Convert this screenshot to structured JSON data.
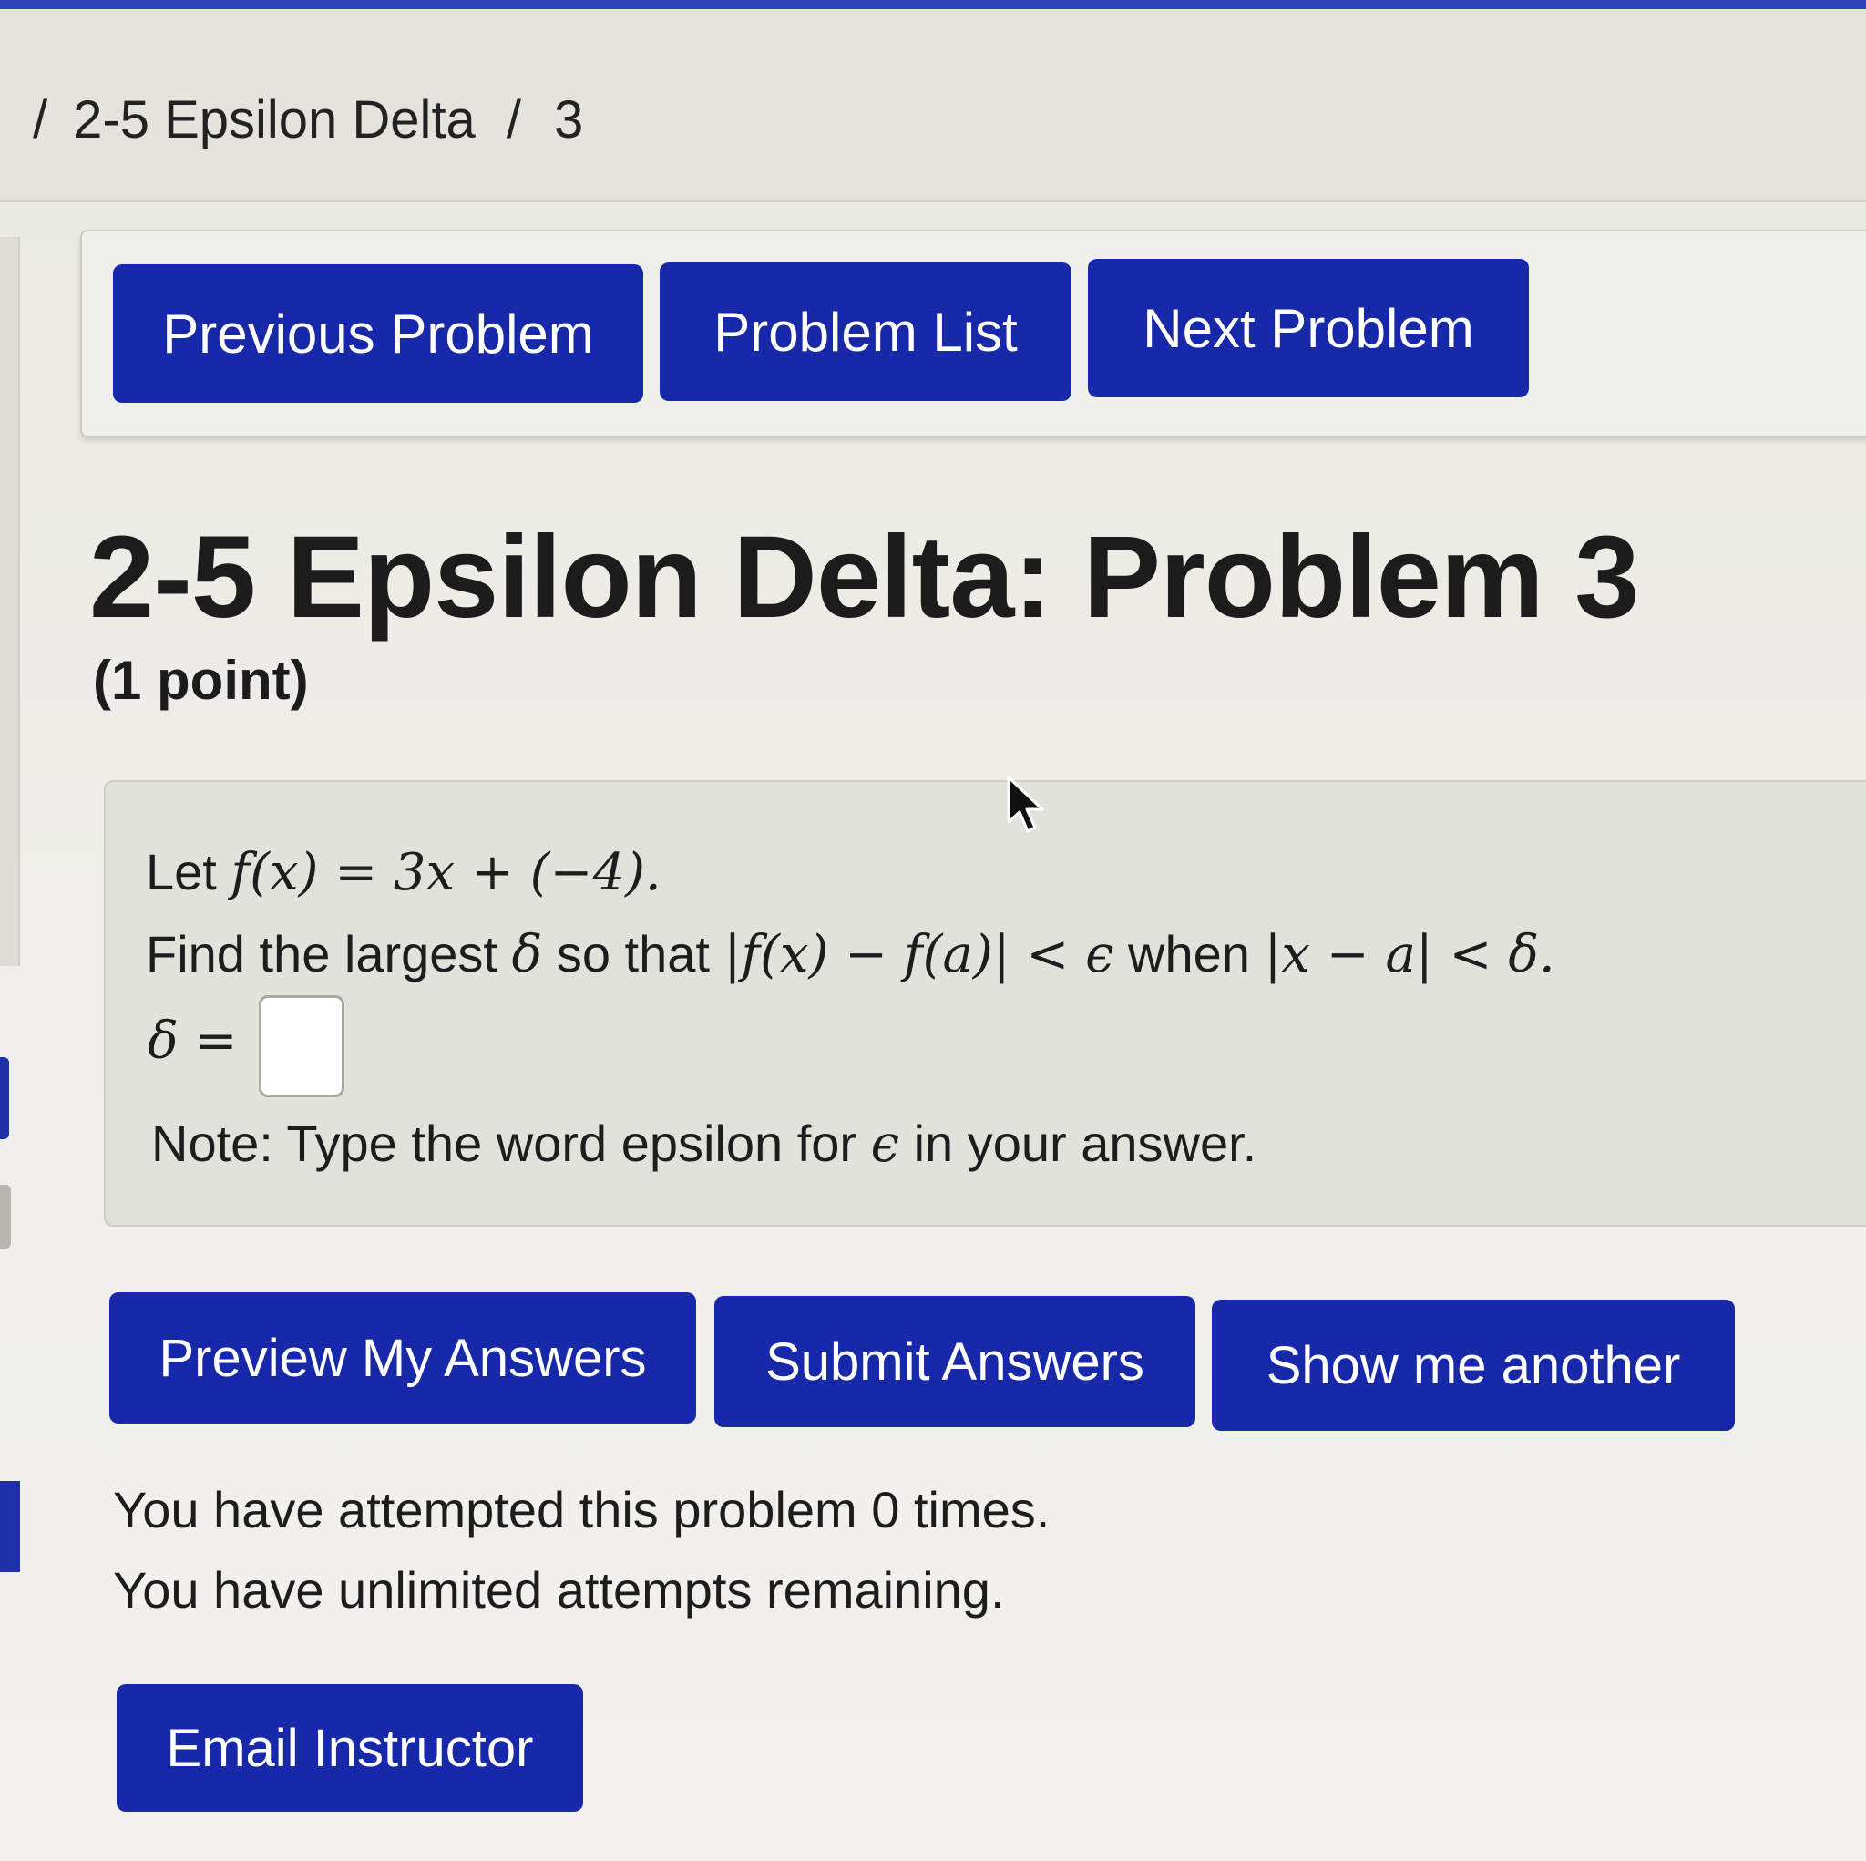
{
  "breadcrumb": {
    "separator": "/",
    "set_name": "2-5 Epsilon Delta",
    "problem_number": "3"
  },
  "nav": {
    "previous_label": "Previous Problem",
    "list_label": "Problem List",
    "next_label": "Next Problem"
  },
  "problem": {
    "title": "2-5 Epsilon Delta: Problem 3",
    "points": "(1 point)",
    "line1": {
      "prefix": "Let ",
      "math": "f(x) = 3x + (−4)."
    },
    "line2": {
      "text_a": "Find the largest ",
      "math_a": "δ",
      "text_b": " so that ",
      "math_b": "|f(x) − f(a)| < ϵ",
      "text_c": " when ",
      "math_c": "|x − a| < δ."
    },
    "answer_label": "δ =",
    "answer_value": "",
    "note": {
      "text_a": "Note: Type the word epsilon for ",
      "math": "ϵ",
      "text_b": " in your answer."
    }
  },
  "actions": {
    "preview_label": "Preview My Answers",
    "submit_label": "Submit Answers",
    "another_label": "Show me another"
  },
  "attempts": {
    "line1": "You have attempted this problem 0 times.",
    "line2": "You have unlimited attempts remaining."
  },
  "email_label": "Email Instructor",
  "colors": {
    "button_blue": "#1729a8",
    "button_text": "#ffffff",
    "text": "#1d1d1d"
  }
}
